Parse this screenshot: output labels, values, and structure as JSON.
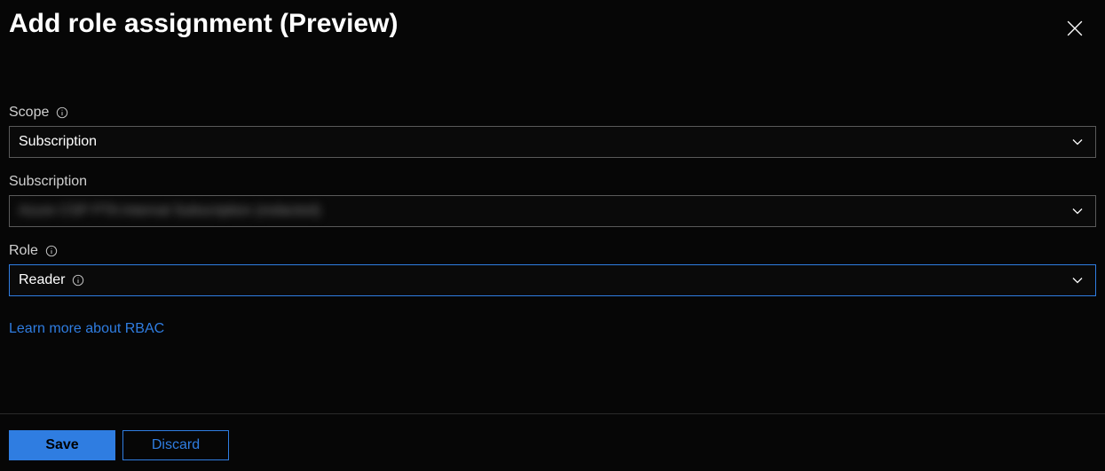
{
  "header": {
    "title": "Add role assignment (Preview)"
  },
  "fields": {
    "scope": {
      "label": "Scope",
      "value": "Subscription"
    },
    "subscription": {
      "label": "Subscription",
      "value": "Azure CSP PTA Internal Subscription (redacted)"
    },
    "role": {
      "label": "Role",
      "value": "Reader"
    }
  },
  "links": {
    "rbac": "Learn more about RBAC"
  },
  "footer": {
    "save": "Save",
    "discard": "Discard"
  },
  "icons": {
    "close": "close-icon",
    "info": "info-icon",
    "chevron": "chevron-down-icon"
  }
}
